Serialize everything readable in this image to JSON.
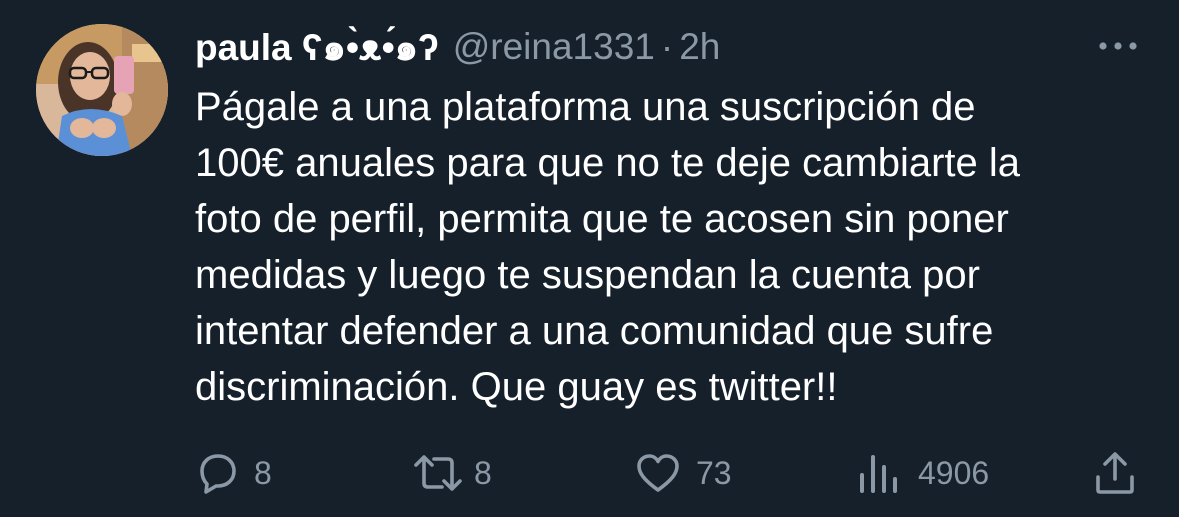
{
  "tweet": {
    "display_name": "paula ʕ๑•̀ᴥ•́๑ʔ",
    "handle": "@reina1331",
    "separator": "·",
    "time": "2h",
    "text": "Págale a una plataforma una suscripción de\n100€ anuales para que no te deje cambiarte la\nfoto de perfil, permita que te acosen sin poner\nmedidas y luego te suspendan la cuenta por\nintentar defender a una comunidad que sufre\ndiscriminación. Que guay es twitter!!"
  },
  "actions": {
    "replies": "8",
    "retweets": "8",
    "likes": "73",
    "views": "4906"
  },
  "icons": {
    "more": "more-horizontal-icon",
    "reply": "reply-icon",
    "retweet": "retweet-icon",
    "like": "heart-icon",
    "views": "analytics-icon",
    "share": "share-icon"
  },
  "colors": {
    "background": "#15202b",
    "text": "#ffffff",
    "muted": "#8b98a5"
  }
}
